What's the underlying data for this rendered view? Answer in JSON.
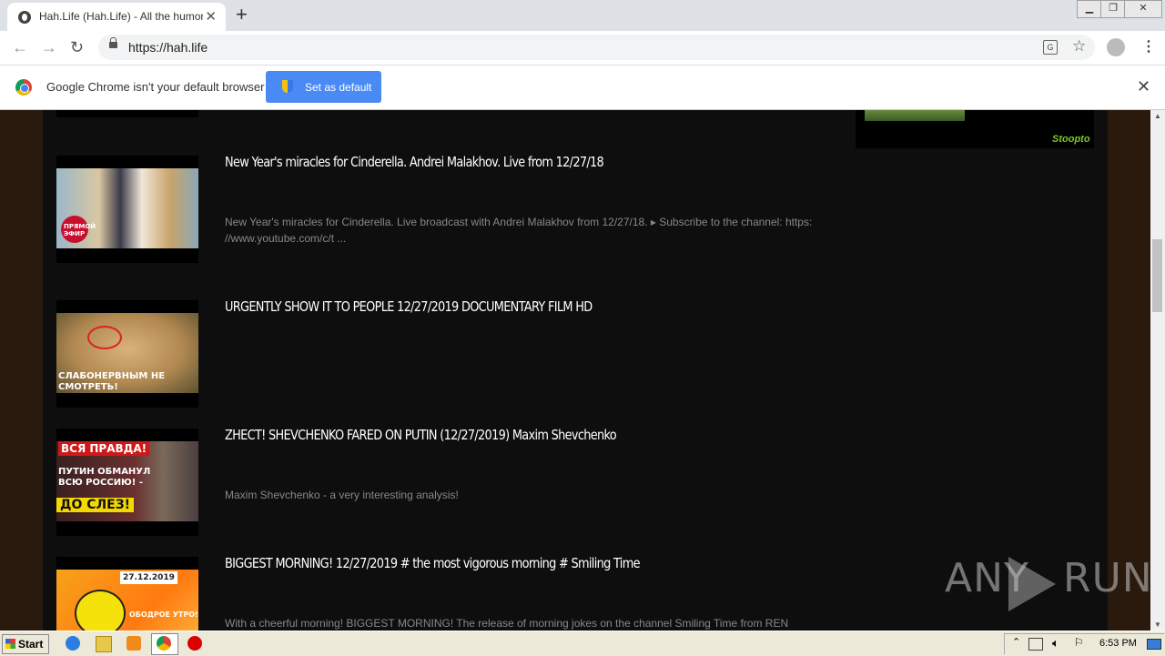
{
  "browser": {
    "tab_title": "Hah.Life (Hah.Life) - All the humor in",
    "url": "https://hah.life",
    "translate_label": "G"
  },
  "infobar": {
    "message": "Google Chrome isn't your default browser",
    "button_label": "Set as default"
  },
  "ad": {
    "logo_text": "Stoopto"
  },
  "videos": [
    {
      "title": "New Year's miracles for Cinderella. Andrei Malakhov. Live from 12/27/18",
      "description": "New Year's miracles for Cinderella. Live broadcast with Andrei Malakhov from 12/27/18. ▸ Subscribe to the channel: https: //www.youtube.com/c/t ...",
      "thumb_text": "ПРЯМОЙ ЭФИР"
    },
    {
      "title": "URGENTLY SHOW IT TO PEOPLE 12/27/2019 DOCUMENTARY FILM HD",
      "description": "",
      "thumb_text": "СЛАБОНЕРВНЫМ НЕ СМОТРЕТЬ!"
    },
    {
      "title": "ZHECT! SHEVCHENKO FARED ON PUTIN (12/27/2019) Maxim Shevchenko",
      "description": "Maxim Shevchenko - a very interesting analysis!",
      "thumb_text_top": "ВСЯ ПРАВДА!",
      "thumb_text_mid": "ПУТИН ОБМАНУЛ ВСЮ РОССИЮ! -",
      "thumb_text_bottom": "ДО СЛЕЗ!"
    },
    {
      "title": "BIGGEST MORNING! 12/27/2019 # the most vigorous morning # Smiling Time",
      "description": "With a cheerful morning! BIGGEST MORNING! The release of morning jokes on the channel Smiling Time from REN",
      "thumb_date": "27.12.2019",
      "thumb_caption": "ОБОДРОЕ УТРО!"
    }
  ],
  "watermark": {
    "left": "ANY",
    "right": "RUN"
  },
  "taskbar": {
    "start_label": "Start",
    "clock": "6:53 PM"
  },
  "colors": {
    "page_bg": "#0e0e0e",
    "title_color": "#ffffff",
    "desc_color": "#888888",
    "button_blue": "#4a8af4"
  }
}
